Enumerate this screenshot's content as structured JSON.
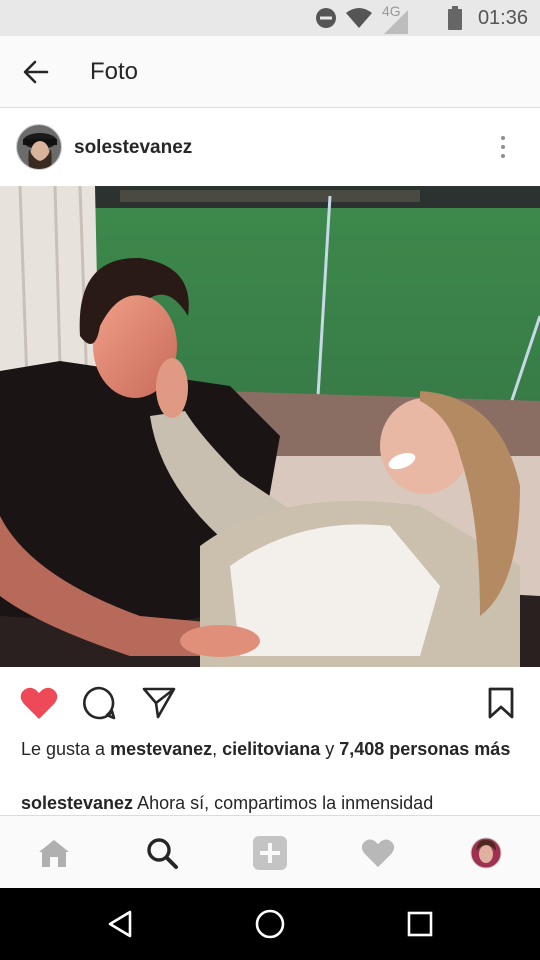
{
  "status_bar": {
    "network_label": "4G",
    "time": "01:36"
  },
  "header": {
    "back_icon": "arrow-left-icon",
    "title": "Foto"
  },
  "post": {
    "username": "solestevanez",
    "more_icon": "more-vertical-icon"
  },
  "actions": {
    "like_icon": "heart-filled-icon",
    "like_color": "#ed4956",
    "comment_icon": "comment-icon",
    "share_icon": "send-icon",
    "save_icon": "bookmark-icon"
  },
  "likes": {
    "prefix": "Le gusta a ",
    "user1": "mestevanez",
    "sep1": ", ",
    "user2": "cielitoviana",
    "sep2": " y ",
    "count": "7,408 personas más"
  },
  "caption": {
    "username": "solestevanez",
    "text": " Ahora sí, compartimos la inmensidad"
  },
  "bottom_nav": {
    "items": [
      "home-icon",
      "search-icon",
      "add-icon",
      "activity-heart-icon",
      "profile-avatar"
    ]
  },
  "system_nav": {
    "items": [
      "back-triangle-icon",
      "home-circle-icon",
      "recents-square-icon"
    ]
  }
}
